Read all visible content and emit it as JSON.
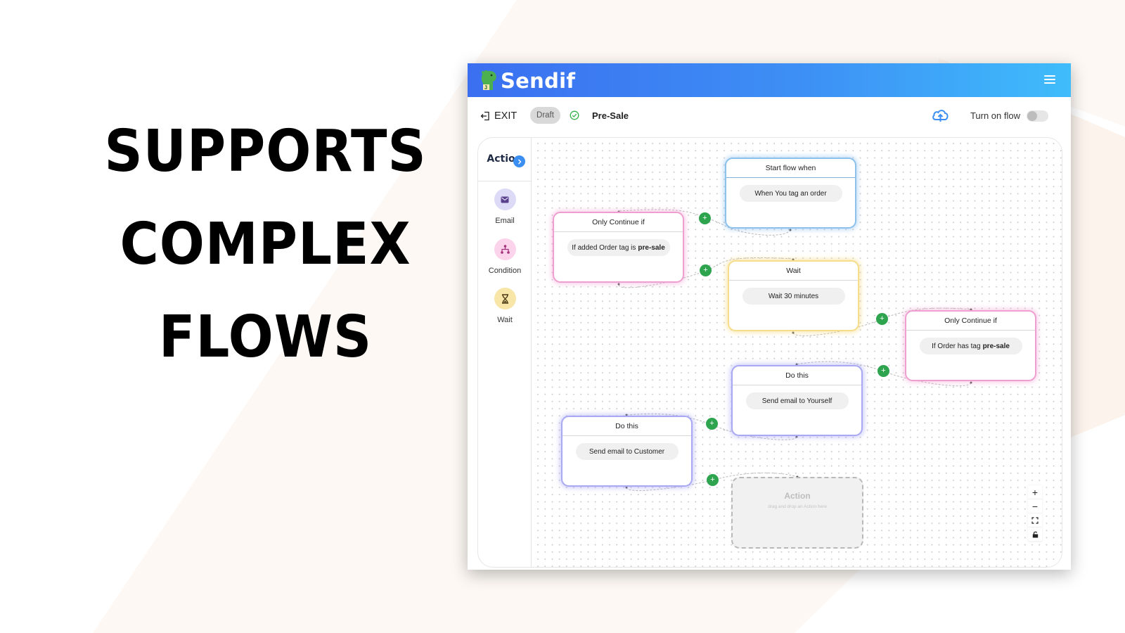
{
  "headline": {
    "lines": [
      "SUPPORTS",
      "COMPLEX",
      "FLOWS"
    ]
  },
  "app": {
    "brand": "Sendif",
    "colors": {
      "header_start": "#3b6ff0",
      "header_end": "#3fbcfb",
      "add_button": "#2ea44f",
      "collapse_button": "#3c8ff2"
    },
    "toolbar": {
      "exit_label": "EXIT",
      "status_badge": "Draft",
      "flow_name": "Pre-Sale",
      "turn_on_label": "Turn on flow",
      "flow_enabled": false
    },
    "sidebar": {
      "title": "Action",
      "items": [
        {
          "label": "Email",
          "icon": "envelope-icon"
        },
        {
          "label": "Condition",
          "icon": "branch-icon"
        },
        {
          "label": "Wait",
          "icon": "hourglass-icon"
        }
      ]
    },
    "nodes": [
      {
        "id": "start",
        "title": "Start flow when",
        "text": "When You tag an order",
        "bold": "",
        "color": "blue"
      },
      {
        "id": "cond1",
        "title": "Only Continue if",
        "text": "If added Order tag is",
        "bold": "pre-sale",
        "color": "pink"
      },
      {
        "id": "wait",
        "title": "Wait",
        "text": "Wait 30 minutes",
        "bold": "",
        "color": "yellow"
      },
      {
        "id": "cond2",
        "title": "Only Continue if",
        "text": "If Order has tag",
        "bold": "pre-sale",
        "color": "pink"
      },
      {
        "id": "do1",
        "title": "Do this",
        "text": "Send email to Yourself",
        "bold": "",
        "color": "purple"
      },
      {
        "id": "do2",
        "title": "Do this",
        "text": "Send email to Customer",
        "bold": "",
        "color": "purple"
      }
    ],
    "placeholder": {
      "title": "Action",
      "subtitle": "drag and drop an Action here"
    },
    "add_button_glyph": "+",
    "zoom_controls": {
      "zoom_in": "+",
      "zoom_out": "−"
    }
  }
}
